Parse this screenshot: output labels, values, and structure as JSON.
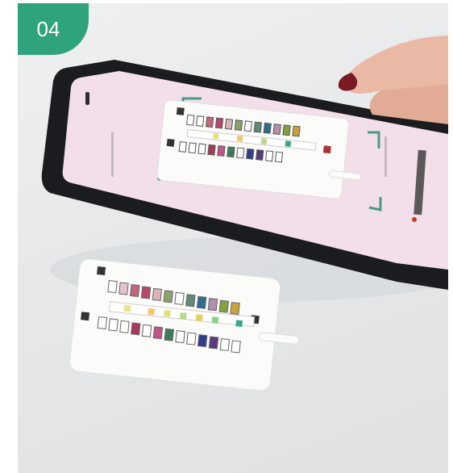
{
  "step_badge": {
    "label": "04",
    "color": "#2fa37c"
  },
  "scene": {
    "icons": [
      "phone",
      "hand",
      "test-strip-card"
    ],
    "colors": {
      "phone_body": "#1b1c1f",
      "screen": "#f1dbe6",
      "frame_guides": "#4a9a86",
      "card": "#fbfbf9",
      "nail": "#7a1a22"
    }
  }
}
